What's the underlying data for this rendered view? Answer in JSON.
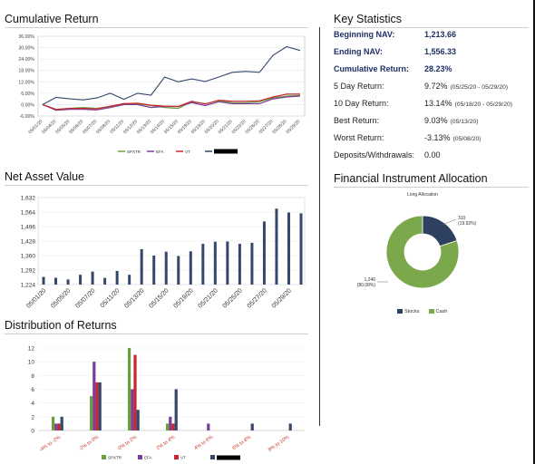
{
  "sections": {
    "cumulative_return_title": "Cumulative Return",
    "nav_title": "Net Asset Value",
    "distribution_title": "Distribution of Returns",
    "key_stats_title": "Key Statistics",
    "allocation_title": "Financial Instrument Allocation"
  },
  "key_statistics": [
    {
      "label": "Beginning NAV:",
      "value": "1,213.66",
      "range": "",
      "bold": true
    },
    {
      "label": "Ending NAV:",
      "value": "1,556.33",
      "range": "",
      "bold": true
    },
    {
      "label": "Cumulative Return:",
      "value": "28.23%",
      "range": "",
      "bold": true
    },
    {
      "label": "5 Day Return:",
      "value": "9.72%",
      "range": "(05/25/20 - 05/29/20)",
      "bold": false
    },
    {
      "label": "10 Day Return:",
      "value": "13.14%",
      "range": "(05/18/20 - 05/29/20)",
      "bold": false
    },
    {
      "label": "Best Return:",
      "value": "9.03%",
      "range": "(05/13/20)",
      "bold": false
    },
    {
      "label": "Worst Return:",
      "value": "-3.13%",
      "range": "(05/08/20)",
      "bold": false
    },
    {
      "label": "Deposits/Withdrawals:",
      "value": "0.00",
      "range": "",
      "bold": false
    }
  ],
  "colors": {
    "navy": "#34486b",
    "green": "#6a9f3e",
    "purple": "#7a3d9a",
    "red": "#c8262e",
    "bars": "#34486b"
  },
  "chart_data": [
    {
      "type": "line",
      "title": "Cumulative Return",
      "x": [
        "05/01/20",
        "05/04/20",
        "05/05/20",
        "05/06/20",
        "05/07/20",
        "05/08/20",
        "05/11/20",
        "05/12/20",
        "05/13/20",
        "05/14/20",
        "05/15/20",
        "05/18/20",
        "05/19/20",
        "05/20/20",
        "05/21/20",
        "05/22/20",
        "05/26/20",
        "05/27/20",
        "05/28/20",
        "05/29/20"
      ],
      "x_tick_labels": [
        "05/01/20",
        "05/04/20",
        "05/05/20",
        "05/06/20",
        "05/07/20",
        "05/08/20",
        "05/11/20",
        "05/12/20",
        "05/13/20",
        "05/14/20",
        "05/15/20",
        "05/18/20",
        "05/19/20",
        "05/20/20",
        "05/21/20",
        "05/22/20",
        "05/26/20",
        "05/27/20",
        "05/28/20",
        "05/29/20"
      ],
      "y_ticks": [
        "36.00%",
        "30.00%",
        "24.00%",
        "18.00%",
        "12.00%",
        "6.00%",
        "0.00%",
        "-6.00%"
      ],
      "ylim": [
        -6,
        36
      ],
      "series": [
        {
          "name": "SPXTR",
          "color": "#6a9f3e",
          "values": [
            0,
            -2.5,
            -2,
            -1.5,
            -2,
            -1,
            0.5,
            0.5,
            -0.5,
            -1.5,
            -2,
            1.5,
            0.5,
            2,
            1,
            1,
            1.5,
            3.5,
            4.5,
            4.8
          ]
        },
        {
          "name": "EFA",
          "color": "#7a3d9a",
          "values": [
            0,
            -3,
            -2.5,
            -2.5,
            -2.8,
            -1.5,
            0,
            0,
            -1.5,
            -1,
            -1,
            1,
            -0.5,
            1.5,
            0.5,
            0.5,
            0.5,
            3,
            4,
            4.5
          ]
        },
        {
          "name": "VT",
          "color": "#c8262e",
          "values": [
            0,
            -2.5,
            -2,
            -2,
            -2.3,
            -0.8,
            0.5,
            0.8,
            -0.3,
            -0.8,
            -1,
            1.8,
            0.3,
            2.3,
            1.8,
            1.8,
            2,
            4,
            5.5,
            5.5
          ]
        },
        {
          "name": "",
          "color": "#34486b",
          "values": [
            0,
            3.8,
            3,
            2.5,
            3.5,
            6,
            2.8,
            6,
            5,
            14.5,
            12,
            13.5,
            12.2,
            14.5,
            17,
            17.5,
            17,
            26,
            30.5,
            28.5
          ]
        }
      ]
    },
    {
      "type": "bar",
      "title": "Net Asset Value",
      "categories": [
        "05/01/20",
        "05/04/20",
        "05/05/20",
        "05/06/20",
        "05/07/20",
        "05/08/20",
        "05/11/20",
        "05/12/20",
        "05/13/20",
        "05/14/20",
        "05/15/20",
        "05/18/20",
        "05/19/20",
        "05/20/20",
        "05/21/20",
        "05/22/20",
        "05/25/20",
        "05/26/20",
        "05/27/20",
        "05/28/20",
        "05/29/20"
      ],
      "x_tick_labels": [
        "05/01/20",
        "05/05/20",
        "05/07/20",
        "05/11/20",
        "05/13/20",
        "05/15/20",
        "05/19/20",
        "05/21/20",
        "05/25/20",
        "05/27/20",
        "05/29/20"
      ],
      "values": [
        1260,
        1256,
        1248,
        1270,
        1285,
        1255,
        1288,
        1270,
        1390,
        1360,
        1378,
        1358,
        1380,
        1415,
        1425,
        1426,
        1415,
        1420,
        1520,
        1580,
        1562,
        1558
      ],
      "y_ticks": [
        "1,632",
        "1,564",
        "1,496",
        "1,428",
        "1,360",
        "1,292",
        "1,224"
      ],
      "ylim": [
        1224,
        1632
      ]
    },
    {
      "type": "bar",
      "title": "Distribution of Returns",
      "categories": [
        "-4% to -2%",
        "-2% to 0%",
        "0% to 2%",
        "2% to 4%",
        "4% to 6%",
        "6% to 8%",
        "8% to 10%"
      ],
      "y_ticks": [
        "12",
        "10",
        "8",
        "6",
        "4",
        "2",
        "0"
      ],
      "ylim": [
        0,
        12
      ],
      "series": [
        {
          "name": "SPXTR",
          "color": "#6a9f3e",
          "values": [
            2,
            5,
            12,
            1,
            0,
            0,
            0
          ]
        },
        {
          "name": "EFA",
          "color": "#7a3d9a",
          "values": [
            1,
            10,
            6,
            2,
            1,
            0,
            0
          ]
        },
        {
          "name": "VT",
          "color": "#c8262e",
          "values": [
            1,
            7,
            11,
            1,
            0,
            0,
            0
          ]
        },
        {
          "name": "",
          "color": "#34486b",
          "values": [
            2,
            7,
            3,
            6,
            0,
            1,
            1
          ]
        }
      ]
    },
    {
      "type": "pie",
      "title": "Long Allocation",
      "slices": [
        {
          "name": "Stocks",
          "value": 310,
          "label": "310",
          "pct_label": "(19.92%)",
          "color": "#2e4060"
        },
        {
          "name": "Cash",
          "value": 1246,
          "label": "1,246",
          "pct_label": "(80.08%)",
          "color": "#7aa84a"
        }
      ]
    }
  ]
}
